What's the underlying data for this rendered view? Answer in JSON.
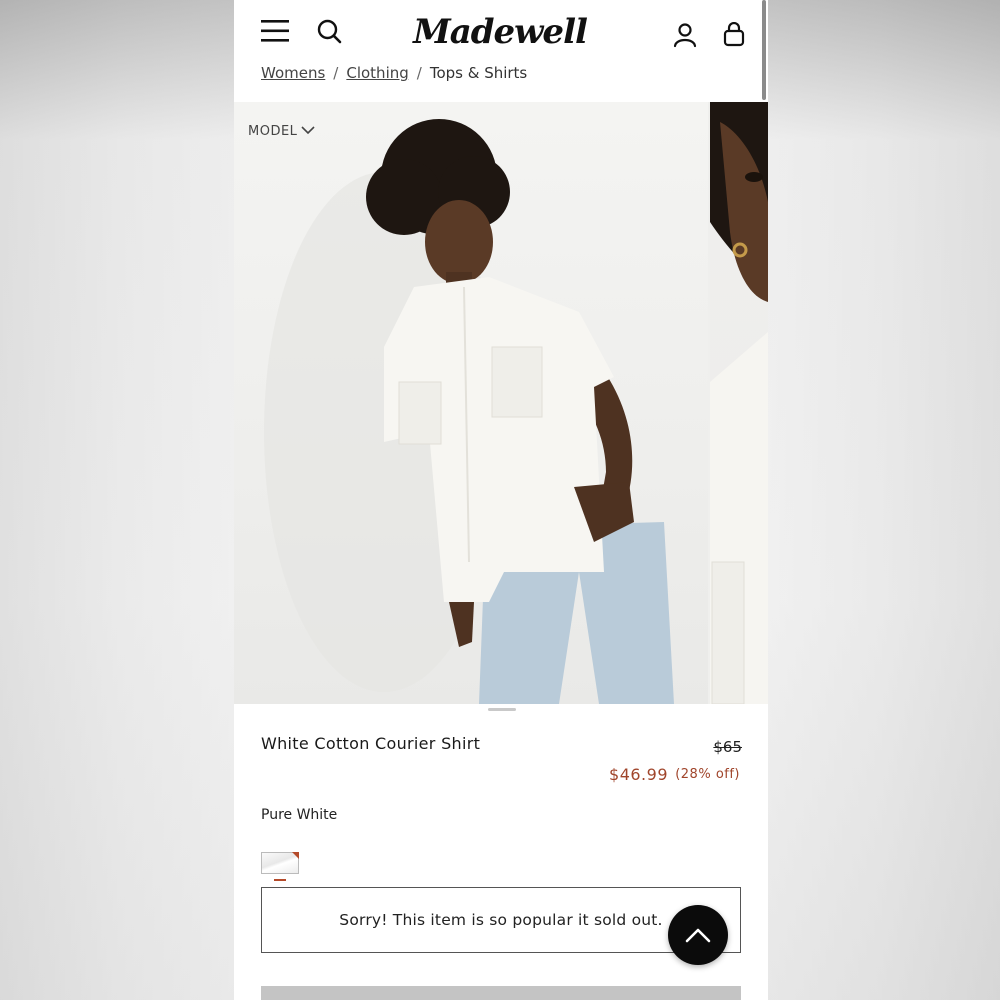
{
  "header": {
    "logo_text": "Madewell",
    "menu_icon": "hamburger-menu-icon",
    "search_icon": "search-icon",
    "account_icon": "account-icon",
    "bag_icon": "shopping-bag-icon"
  },
  "breadcrumb": {
    "items": [
      "Womens",
      "Clothing",
      "Tops & Shirts"
    ],
    "separator": "/"
  },
  "gallery": {
    "model_toggle_label": "MODEL"
  },
  "product": {
    "title": "White Cotton Courier Shirt",
    "original_price": "$65",
    "sale_price": "$46.99",
    "discount": "(28% off)",
    "color_name": "Pure White",
    "sold_out_message": "Sorry! This item is so popular it sold out."
  },
  "colors": {
    "sale": "#a0452b",
    "text": "#1a1a1a",
    "button": "#0b0b0b"
  }
}
